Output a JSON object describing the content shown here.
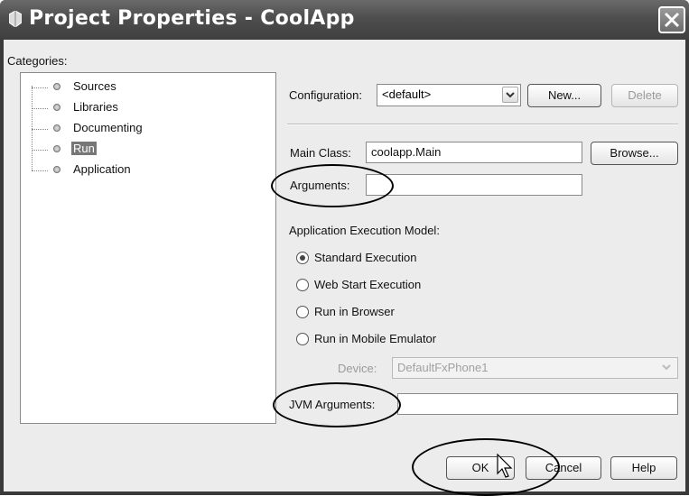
{
  "window": {
    "title": "Project Properties - CoolApp"
  },
  "categories": {
    "label": "Categories:",
    "items": [
      {
        "label": "Sources",
        "selected": false
      },
      {
        "label": "Libraries",
        "selected": false
      },
      {
        "label": "Documenting",
        "selected": false
      },
      {
        "label": "Run",
        "selected": true
      },
      {
        "label": "Application",
        "selected": false
      }
    ]
  },
  "config": {
    "label": "Configuration:",
    "value": "<default>",
    "new_label": "New...",
    "delete_label": "Delete"
  },
  "main_class": {
    "label": "Main Class:",
    "value": "coolapp.Main",
    "browse_label": "Browse..."
  },
  "arguments": {
    "label": "Arguments:",
    "value": ""
  },
  "exec_model": {
    "label": "Application Execution Model:",
    "options": [
      {
        "label": "Standard Execution",
        "checked": true
      },
      {
        "label": "Web Start Execution",
        "checked": false
      },
      {
        "label": "Run in Browser",
        "checked": false
      },
      {
        "label": "Run in Mobile Emulator",
        "checked": false
      }
    ],
    "device_label": "Device:",
    "device_value": "DefaultFxPhone1"
  },
  "jvm_arguments": {
    "label": "JVM Arguments:",
    "value": ""
  },
  "footer": {
    "ok_label": "OK",
    "cancel_label": "Cancel",
    "help_label": "Help"
  }
}
